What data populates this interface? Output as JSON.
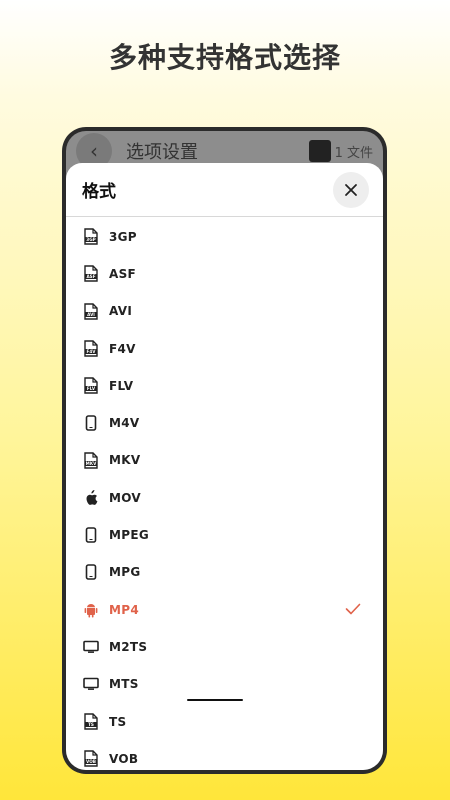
{
  "promo_title": "多种支持格式选择",
  "background_screen": {
    "title": "选项设置",
    "files_label": "1 文件"
  },
  "sheet": {
    "title": "格式",
    "close_label": "✕"
  },
  "formats": [
    {
      "label": "3GP",
      "icon": "file-3gp-icon"
    },
    {
      "label": "ASF",
      "icon": "file-asf-icon"
    },
    {
      "label": "AVI",
      "icon": "file-avi-icon"
    },
    {
      "label": "F4V",
      "icon": "file-f4v-icon"
    },
    {
      "label": "FLV",
      "icon": "file-flv-icon"
    },
    {
      "label": "M4V",
      "icon": "phone-icon"
    },
    {
      "label": "MKV",
      "icon": "file-mkv-icon"
    },
    {
      "label": "MOV",
      "icon": "apple-icon"
    },
    {
      "label": "MPEG",
      "icon": "phone-icon"
    },
    {
      "label": "MPG",
      "icon": "phone-icon"
    },
    {
      "label": "MP4",
      "icon": "android-icon",
      "selected": true
    },
    {
      "label": "M2TS",
      "icon": "tv-icon"
    },
    {
      "label": "MTS",
      "icon": "tv-icon"
    },
    {
      "label": "TS",
      "icon": "file-ts-icon"
    },
    {
      "label": "VOB",
      "icon": "file-vob-icon"
    }
  ],
  "colors": {
    "accent": "#e0624a",
    "text": "#222222"
  }
}
